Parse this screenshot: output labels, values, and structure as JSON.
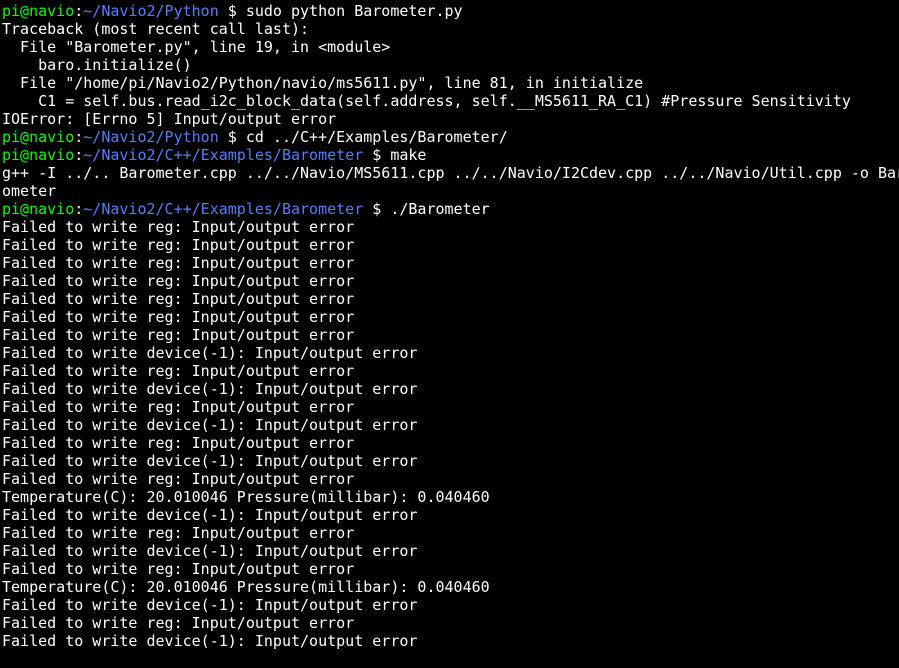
{
  "accent": {
    "green": "#00ff00",
    "blue": "#4f7fff",
    "white": "#ffffff",
    "bg": "#000000"
  },
  "lines": [
    {
      "segments": [
        {
          "cls": "green",
          "text": "pi@navio"
        },
        {
          "cls": "white",
          "text": ":"
        },
        {
          "cls": "blue",
          "text": "~/Navio2/Python"
        },
        {
          "cls": "white",
          "text": " $ sudo python Barometer.py"
        }
      ]
    },
    {
      "segments": [
        {
          "cls": "white",
          "text": "Traceback (most recent call last):"
        }
      ]
    },
    {
      "segments": [
        {
          "cls": "white",
          "text": "  File \"Barometer.py\", line 19, in <module>"
        }
      ]
    },
    {
      "segments": [
        {
          "cls": "white",
          "text": "    baro.initialize()"
        }
      ]
    },
    {
      "segments": [
        {
          "cls": "white",
          "text": "  File \"/home/pi/Navio2/Python/navio/ms5611.py\", line 81, in initialize"
        }
      ]
    },
    {
      "segments": [
        {
          "cls": "white",
          "text": "    C1 = self.bus.read_i2c_block_data(self.address, self.__MS5611_RA_C1) #Pressure Sensitivity"
        }
      ]
    },
    {
      "segments": [
        {
          "cls": "white",
          "text": "IOError: [Errno 5] Input/output error"
        }
      ]
    },
    {
      "segments": [
        {
          "cls": "green",
          "text": "pi@navio"
        },
        {
          "cls": "white",
          "text": ":"
        },
        {
          "cls": "blue",
          "text": "~/Navio2/Python"
        },
        {
          "cls": "white",
          "text": " $ cd ../C++/Examples/Barometer/"
        }
      ]
    },
    {
      "segments": [
        {
          "cls": "green",
          "text": "pi@navio"
        },
        {
          "cls": "white",
          "text": ":"
        },
        {
          "cls": "blue",
          "text": "~/Navio2/C++/Examples/Barometer"
        },
        {
          "cls": "white",
          "text": " $ make"
        }
      ]
    },
    {
      "segments": [
        {
          "cls": "white",
          "text": "g++ -I ../.. Barometer.cpp ../../Navio/MS5611.cpp ../../Navio/I2Cdev.cpp ../../Navio/Util.cpp -o Bar"
        }
      ]
    },
    {
      "segments": [
        {
          "cls": "white",
          "text": "ometer"
        }
      ]
    },
    {
      "segments": [
        {
          "cls": "green",
          "text": "pi@navio"
        },
        {
          "cls": "white",
          "text": ":"
        },
        {
          "cls": "blue",
          "text": "~/Navio2/C++/Examples/Barometer"
        },
        {
          "cls": "white",
          "text": " $ ./Barometer"
        }
      ]
    },
    {
      "segments": [
        {
          "cls": "white",
          "text": "Failed to write reg: Input/output error"
        }
      ]
    },
    {
      "segments": [
        {
          "cls": "white",
          "text": "Failed to write reg: Input/output error"
        }
      ]
    },
    {
      "segments": [
        {
          "cls": "white",
          "text": "Failed to write reg: Input/output error"
        }
      ]
    },
    {
      "segments": [
        {
          "cls": "white",
          "text": "Failed to write reg: Input/output error"
        }
      ]
    },
    {
      "segments": [
        {
          "cls": "white",
          "text": "Failed to write reg: Input/output error"
        }
      ]
    },
    {
      "segments": [
        {
          "cls": "white",
          "text": "Failed to write reg: Input/output error"
        }
      ]
    },
    {
      "segments": [
        {
          "cls": "white",
          "text": "Failed to write reg: Input/output error"
        }
      ]
    },
    {
      "segments": [
        {
          "cls": "white",
          "text": "Failed to write device(-1): Input/output error"
        }
      ]
    },
    {
      "segments": [
        {
          "cls": "white",
          "text": "Failed to write reg: Input/output error"
        }
      ]
    },
    {
      "segments": [
        {
          "cls": "white",
          "text": "Failed to write device(-1): Input/output error"
        }
      ]
    },
    {
      "segments": [
        {
          "cls": "white",
          "text": "Failed to write reg: Input/output error"
        }
      ]
    },
    {
      "segments": [
        {
          "cls": "white",
          "text": "Failed to write device(-1): Input/output error"
        }
      ]
    },
    {
      "segments": [
        {
          "cls": "white",
          "text": "Failed to write reg: Input/output error"
        }
      ]
    },
    {
      "segments": [
        {
          "cls": "white",
          "text": "Failed to write device(-1): Input/output error"
        }
      ]
    },
    {
      "segments": [
        {
          "cls": "white",
          "text": "Failed to write reg: Input/output error"
        }
      ]
    },
    {
      "segments": [
        {
          "cls": "white",
          "text": "Temperature(C): 20.010046 Pressure(millibar): 0.040460"
        }
      ]
    },
    {
      "segments": [
        {
          "cls": "white",
          "text": "Failed to write device(-1): Input/output error"
        }
      ]
    },
    {
      "segments": [
        {
          "cls": "white",
          "text": "Failed to write reg: Input/output error"
        }
      ]
    },
    {
      "segments": [
        {
          "cls": "white",
          "text": "Failed to write device(-1): Input/output error"
        }
      ]
    },
    {
      "segments": [
        {
          "cls": "white",
          "text": "Failed to write reg: Input/output error"
        }
      ]
    },
    {
      "segments": [
        {
          "cls": "white",
          "text": "Temperature(C): 20.010046 Pressure(millibar): 0.040460"
        }
      ]
    },
    {
      "segments": [
        {
          "cls": "white",
          "text": "Failed to write device(-1): Input/output error"
        }
      ]
    },
    {
      "segments": [
        {
          "cls": "white",
          "text": "Failed to write reg: Input/output error"
        }
      ]
    },
    {
      "segments": [
        {
          "cls": "white",
          "text": "Failed to write device(-1): Input/output error"
        }
      ]
    }
  ],
  "sensor_readings": [
    {
      "temperature_c": 20.010046,
      "pressure_millibar": 0.04046
    },
    {
      "temperature_c": 20.010046,
      "pressure_millibar": 0.04046
    }
  ]
}
